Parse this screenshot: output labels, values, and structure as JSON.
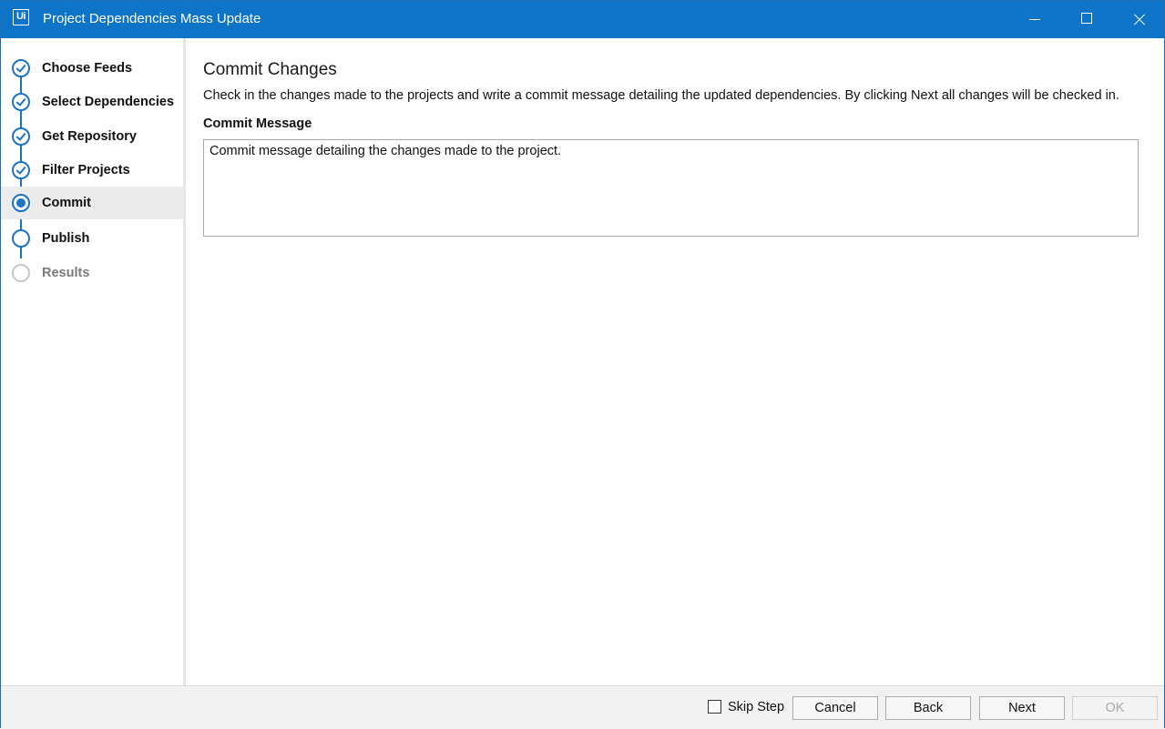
{
  "window": {
    "app_icon_text": "Ui",
    "title": "Project Dependencies Mass Update"
  },
  "steps": [
    {
      "label": "Choose Feeds",
      "state": "done"
    },
    {
      "label": "Select Dependencies",
      "state": "done"
    },
    {
      "label": "Get Repository",
      "state": "done"
    },
    {
      "label": "Filter Projects",
      "state": "done"
    },
    {
      "label": "Commit",
      "state": "current"
    },
    {
      "label": "Publish",
      "state": "upcoming"
    },
    {
      "label": "Results",
      "state": "disabled"
    }
  ],
  "main": {
    "heading": "Commit Changes",
    "description": "Check in the changes made to the projects and write a commit message detailing the updated dependencies. By clicking Next all changes will be checked in.",
    "commit_label": "Commit Message",
    "commit_value": "Commit message detailing the changes made to the project."
  },
  "footer": {
    "skip_label": "Skip Step",
    "skip_checked": false,
    "cancel": "Cancel",
    "back": "Back",
    "next": "Next",
    "ok": "OK"
  },
  "colors": {
    "titlebar": "#0d74c7",
    "accent": "#1a73c4"
  }
}
